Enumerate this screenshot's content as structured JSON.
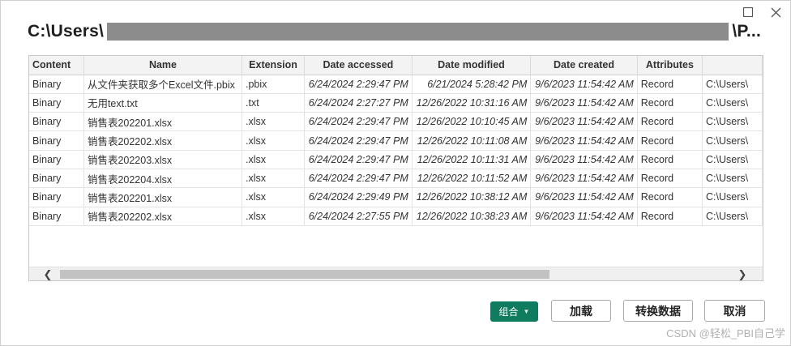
{
  "window": {
    "title_prefix": "C:\\Users\\",
    "title_suffix": "\\P..."
  },
  "table": {
    "columns": [
      "Content",
      "Name",
      "Extension",
      "Date accessed",
      "Date modified",
      "Date created",
      "Attributes",
      ""
    ],
    "rows": [
      [
        "Binary",
        "从文件夹获取多个Excel文件.pbix",
        ".pbix",
        "6/24/2024 2:29:47 PM",
        "6/21/2024 5:28:42 PM",
        "9/6/2023 11:54:42 AM",
        "Record",
        "C:\\Users\\"
      ],
      [
        "Binary",
        "无用text.txt",
        ".txt",
        "6/24/2024 2:27:27 PM",
        "12/26/2022 10:31:16 AM",
        "9/6/2023 11:54:42 AM",
        "Record",
        "C:\\Users\\"
      ],
      [
        "Binary",
        "销售表202201.xlsx",
        ".xlsx",
        "6/24/2024 2:29:47 PM",
        "12/26/2022 10:10:45 AM",
        "9/6/2023 11:54:42 AM",
        "Record",
        "C:\\Users\\"
      ],
      [
        "Binary",
        "销售表202202.xlsx",
        ".xlsx",
        "6/24/2024 2:29:47 PM",
        "12/26/2022 10:11:08 AM",
        "9/6/2023 11:54:42 AM",
        "Record",
        "C:\\Users\\"
      ],
      [
        "Binary",
        "销售表202203.xlsx",
        ".xlsx",
        "6/24/2024 2:29:47 PM",
        "12/26/2022 10:11:31 AM",
        "9/6/2023 11:54:42 AM",
        "Record",
        "C:\\Users\\"
      ],
      [
        "Binary",
        "销售表202204.xlsx",
        ".xlsx",
        "6/24/2024 2:29:47 PM",
        "12/26/2022 10:11:52 AM",
        "9/6/2023 11:54:42 AM",
        "Record",
        "C:\\Users\\"
      ],
      [
        "Binary",
        "销售表202201.xlsx",
        ".xlsx",
        "6/24/2024 2:29:49 PM",
        "12/26/2022 10:38:12 AM",
        "9/6/2023 11:54:42 AM",
        "Record",
        "C:\\Users\\"
      ],
      [
        "Binary",
        "销售表202202.xlsx",
        ".xlsx",
        "6/24/2024 2:27:55 PM",
        "12/26/2022 10:38:23 AM",
        "9/6/2023 11:54:42 AM",
        "Record",
        "C:\\Users\\"
      ]
    ]
  },
  "scrollbar": {
    "left_arrow": "❮",
    "right_arrow": "❯",
    "thumb_fraction": 0.73
  },
  "buttons": {
    "combine": "组合",
    "combine_caret": "▼",
    "load": "加载",
    "transform": "转换数据",
    "cancel": "取消"
  },
  "icons": {
    "maximize": "maximize-icon",
    "close": "close-icon"
  },
  "colors": {
    "accent": "#107c5f",
    "redaction": "#8c8c8c"
  },
  "watermark": "CSDN @轻松_PBI自己学"
}
